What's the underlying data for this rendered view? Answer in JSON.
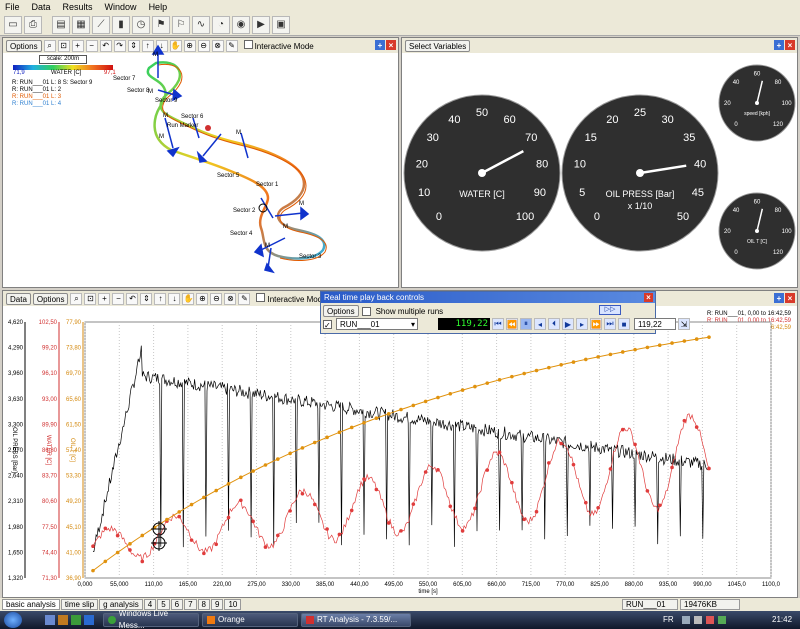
{
  "menu": [
    "File",
    "Data",
    "Results",
    "Window",
    "Help"
  ],
  "map_panel": {
    "options_label": "Options",
    "interactive_label": "Interactive Mode",
    "scale_label": "scale: 200m",
    "color_min": "71,9",
    "color_max": "97,1",
    "color_label": "WATER [C]",
    "legend": [
      {
        "text": "R: RUN___01 L: 8 S: Sector 9",
        "color": "#000000"
      },
      {
        "text": "R: RUN___01 L: 2",
        "color": "#000000"
      },
      {
        "text": "R: RUN___01 L: 3",
        "color": "#e05a00"
      },
      {
        "text": "R: RUN___01 L: 4",
        "color": "#2d7fd0"
      }
    ],
    "sectors": [
      "Sector 7",
      "Sector 8",
      "Sector 9",
      "Sector 5",
      "Sector 1",
      "Sector 2",
      "Sector 4",
      "Sector 3",
      "Sector 6"
    ],
    "markers": [
      "M",
      "M",
      "M",
      "M",
      "M",
      "M",
      "M",
      "M"
    ],
    "run_marker": "Run Marker"
  },
  "gauge_panel": {
    "select_label": "Select Variables",
    "water": {
      "label": "WATER [C]",
      "ticks": [
        "20",
        "30",
        "40",
        "50",
        "60",
        "70",
        "80",
        "90",
        "100",
        "10",
        "0"
      ],
      "value": 73
    },
    "oil": {
      "label": "OIL PRESS [Bar]",
      "sub": "x 1/10",
      "ticks": [
        "15",
        "20",
        "25",
        "30",
        "35",
        "40",
        "45",
        "50",
        "10",
        "5",
        "0"
      ],
      "value": 40
    },
    "speed": {
      "label": "speed [kph]",
      "ticks": [
        "0",
        "20",
        "40",
        "60",
        "80",
        "100",
        "120"
      ],
      "value": 0
    },
    "oil_temp": {
      "label": "OIL T [C]",
      "ticks": [
        "0",
        "20",
        "40",
        "60",
        "80",
        "100",
        "120"
      ],
      "value": 0
    }
  },
  "graph_panel": {
    "data_label": "Data",
    "options_label": "Options",
    "interactive_label": "Interactive Mode",
    "y_axes": [
      {
        "label": "OIL PRESS [Bar]",
        "color": "#000000",
        "ticks": [
          "4,620",
          "4,290",
          "3,960",
          "3,630",
          "3,300",
          "2,970",
          "2,640",
          "2,310",
          "1,980",
          "1,650",
          "1,320"
        ]
      },
      {
        "label": "WATER [C]",
        "color": "#d03030",
        "ticks": [
          "102,50",
          "99,20",
          "96,10",
          "93,00",
          "89,90",
          "86,80",
          "83,70",
          "80,60",
          "77,50",
          "74,40",
          "71,30"
        ]
      },
      {
        "label": "OIL T [C]",
        "color": "#d48a10",
        "ticks": [
          "77,90",
          "73,80",
          "69,70",
          "65,60",
          "61,50",
          "57,40",
          "53,30",
          "49,20",
          "45,10",
          "41,00",
          "36,90"
        ]
      }
    ],
    "x_ticks": [
      "0,000",
      "55,000",
      "110,00",
      "165,00",
      "220,00",
      "275,00",
      "330,00",
      "385,00",
      "440,00",
      "495,00",
      "550,00",
      "605,00",
      "660,00",
      "715,00",
      "770,00",
      "825,00",
      "880,00",
      "935,00",
      "990,00",
      "1045,0",
      "1100,0"
    ],
    "x_label": "time [s]",
    "legend": [
      {
        "text": "R: RUN___01, 0,00 to 16:42,59",
        "color": "#000000"
      },
      {
        "text": "R: RUN___01, 0,00 to 16:42,59",
        "color": "#d03030"
      },
      {
        "text": "R: RUN___01, 0,00 to 16:42,59",
        "color": "#d48a10"
      }
    ]
  },
  "playback": {
    "title": "Real time play back controls",
    "options_label": "Options",
    "show_multiple_label": "Show multiple runs",
    "run_value": "RUN___01",
    "time_display": "119,22",
    "time_field": "119,22"
  },
  "tabs": [
    "basic analysis",
    "time slip",
    "g analysis",
    "4",
    "5",
    "6",
    "7",
    "8",
    "9",
    "10"
  ],
  "status": {
    "run": "RUN___01",
    "memory": "19476KB"
  },
  "taskbar": {
    "items": [
      "Windows Live Mess...",
      "Orange",
      "RT Analysis - 7.3.59/..."
    ],
    "locale": "FR",
    "clock": "21:42"
  },
  "colors": {
    "oil_press": "#000000",
    "water": "#e03c3c",
    "oil_temp": "#e0920e",
    "marker": "#1033cc"
  }
}
